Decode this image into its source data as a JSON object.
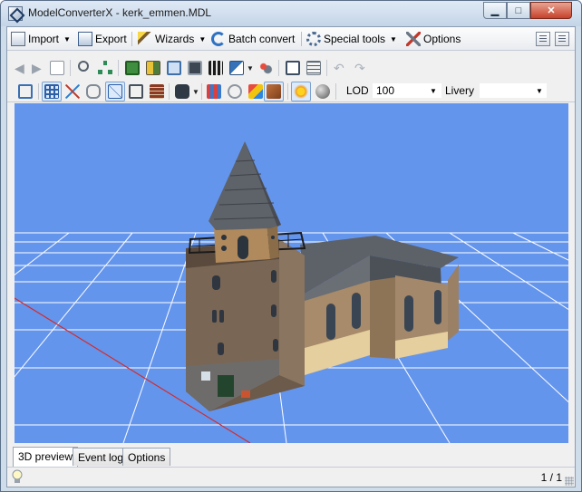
{
  "window": {
    "title": "ModelConverterX - kerk_emmen.MDL"
  },
  "menubar": {
    "import_label": "Import",
    "export_label": "Export",
    "wizards_label": "Wizards",
    "batch_convert_label": "Batch convert",
    "special_tools_label": "Special tools",
    "options_label": "Options"
  },
  "toolbar": {
    "lod_label": "LOD",
    "lod_value": "100",
    "livery_label": "Livery",
    "livery_value": ""
  },
  "tabs": [
    {
      "label": "3D preview",
      "active": true
    },
    {
      "label": "Event log",
      "active": false
    },
    {
      "label": "Options",
      "active": false
    }
  ],
  "status": {
    "page": "1 / 1"
  },
  "colors": {
    "viewport_background": "#6495ed",
    "grid_lines": "#ffffff",
    "x_axis": "#d42b2b",
    "titlebar": "#c4d5e8"
  },
  "icons": [
    "app-icon",
    "import-icon",
    "export-icon",
    "wizard-wand-icon",
    "batch-convert-icon",
    "special-tools-gear-icon",
    "options-tools-icon",
    "help-icon",
    "back-arrow-icon",
    "forward-arrow-icon",
    "document-icon",
    "zoom-icon",
    "hierarchy-icon",
    "image-icon",
    "texture-icon",
    "copy-icon",
    "camera-icon",
    "film-icon",
    "export-arrow-icon",
    "settings-icon",
    "picture-icon",
    "list-icon",
    "undo-icon",
    "redo-icon",
    "zoom-extents-icon",
    "grid-icon",
    "axis-icon",
    "link-icon",
    "wireframe-icon",
    "cube-icon",
    "bricks-icon",
    "camera-view-icon",
    "render-icon",
    "normals-icon",
    "color-cube-icon",
    "solid-cube-icon",
    "sun-icon",
    "sphere-icon",
    "lightbulb-icon"
  ]
}
